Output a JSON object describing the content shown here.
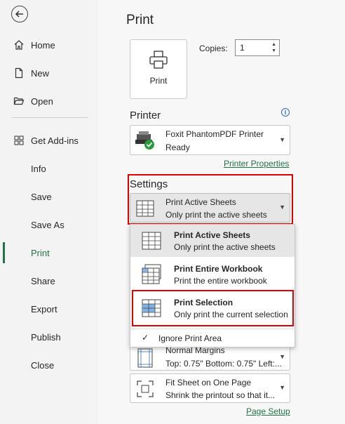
{
  "sidebar": {
    "items": [
      {
        "label": "Home",
        "icon": "home-icon"
      },
      {
        "label": "New",
        "icon": "new-document-icon"
      },
      {
        "label": "Open",
        "icon": "folder-open-icon"
      },
      {
        "label": "Get Add-ins",
        "icon": "add-ins-grid-icon"
      },
      {
        "label": "Info"
      },
      {
        "label": "Save"
      },
      {
        "label": "Save As"
      },
      {
        "label": "Print",
        "active": true
      },
      {
        "label": "Share"
      },
      {
        "label": "Export"
      },
      {
        "label": "Publish"
      },
      {
        "label": "Close"
      }
    ],
    "active_color": "#217346"
  },
  "main": {
    "title": "Print",
    "print_button": "Print",
    "copies_label": "Copies:",
    "copies_value": "1",
    "printer_heading": "Printer",
    "printer": {
      "name": "Foxit PhantomPDF Printer",
      "status": "Ready"
    },
    "printer_properties": "Printer Properties",
    "settings_heading": "Settings",
    "settings_current": {
      "title": "Print Active Sheets",
      "subtitle": "Only print the active sheets"
    },
    "margins": {
      "title": "Normal Margins",
      "subtitle": "Top: 0.75\" Bottom: 0.75\" Left:..."
    },
    "scaling": {
      "title": "Fit Sheet on One Page",
      "subtitle": "Shrink the printout so that it..."
    },
    "page_setup": "Page Setup"
  },
  "menu": {
    "items": [
      {
        "title": "Print Active Sheets",
        "subtitle": "Only print the active sheets",
        "selected": true
      },
      {
        "title": "Print Entire Workbook",
        "subtitle": "Print the entire workbook"
      },
      {
        "title": "Print Selection",
        "subtitle": "Only print the current selection"
      }
    ],
    "ignore_print_area": "Ignore Print Area",
    "ignore_checked": true
  },
  "highlight_color": "#e00000"
}
